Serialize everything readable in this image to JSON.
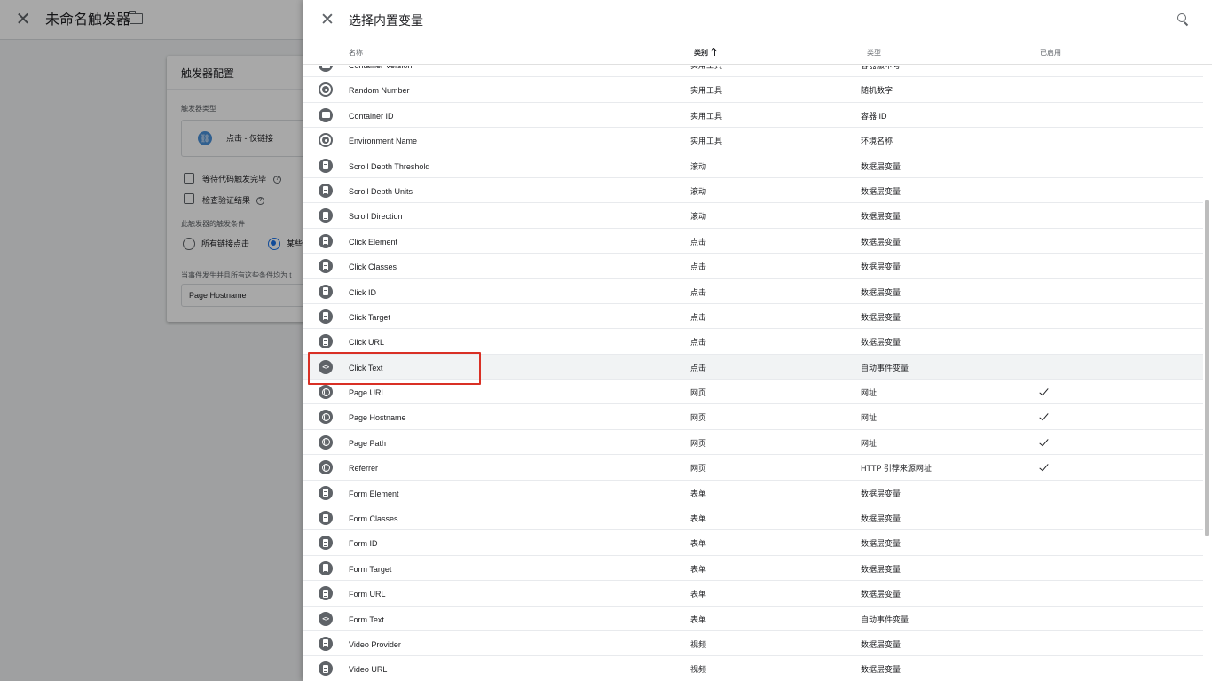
{
  "background": {
    "title": "未命名触发器",
    "card_title": "触发器配置",
    "trigger_type_label": "触发器类型",
    "trigger_type_value": "点击 - 仅链接",
    "wait_for_tags": "等待代码触发完毕",
    "check_validation": "检查验证结果",
    "fire_conditions_label": "此触发器的触发条件",
    "radio_all": "所有链接点击",
    "radio_some": "某些",
    "condition_text": "当事件发生并且所有这些条件均为 t",
    "condition_input_value": "Page Hostname"
  },
  "panel": {
    "title": "选择内置变量",
    "columns": {
      "name": "名称",
      "category": "类别",
      "type": "类型",
      "enabled": "已启用"
    }
  },
  "rows": [
    {
      "icon": "box",
      "name": "Container Version",
      "category": "实用工具",
      "type": "容器版本号",
      "enabled": false
    },
    {
      "icon": "gear",
      "name": "Random Number",
      "category": "实用工具",
      "type": "随机数字",
      "enabled": false
    },
    {
      "icon": "box",
      "name": "Container ID",
      "category": "实用工具",
      "type": "容器 ID",
      "enabled": false
    },
    {
      "icon": "gear",
      "name": "Environment Name",
      "category": "实用工具",
      "type": "环境名称",
      "enabled": false
    },
    {
      "icon": "doc",
      "name": "Scroll Depth Threshold",
      "category": "滚动",
      "type": "数据层变量",
      "enabled": false
    },
    {
      "icon": "doc",
      "name": "Scroll Depth Units",
      "category": "滚动",
      "type": "数据层变量",
      "enabled": false
    },
    {
      "icon": "doc",
      "name": "Scroll Direction",
      "category": "滚动",
      "type": "数据层变量",
      "enabled": false
    },
    {
      "icon": "doc",
      "name": "Click Element",
      "category": "点击",
      "type": "数据层变量",
      "enabled": false
    },
    {
      "icon": "doc",
      "name": "Click Classes",
      "category": "点击",
      "type": "数据层变量",
      "enabled": false
    },
    {
      "icon": "doc",
      "name": "Click ID",
      "category": "点击",
      "type": "数据层变量",
      "enabled": false
    },
    {
      "icon": "doc",
      "name": "Click Target",
      "category": "点击",
      "type": "数据层变量",
      "enabled": false
    },
    {
      "icon": "doc",
      "name": "Click URL",
      "category": "点击",
      "type": "数据层变量",
      "enabled": false
    },
    {
      "icon": "code",
      "name": "Click Text",
      "category": "点击",
      "type": "自动事件变量",
      "enabled": false,
      "highlighted": true
    },
    {
      "icon": "globe",
      "name": "Page URL",
      "category": "网页",
      "type": "网址",
      "enabled": true
    },
    {
      "icon": "globe",
      "name": "Page Hostname",
      "category": "网页",
      "type": "网址",
      "enabled": true
    },
    {
      "icon": "globe",
      "name": "Page Path",
      "category": "网页",
      "type": "网址",
      "enabled": true
    },
    {
      "icon": "globe",
      "name": "Referrer",
      "category": "网页",
      "type": "HTTP 引荐来源网址",
      "enabled": true
    },
    {
      "icon": "doc",
      "name": "Form Element",
      "category": "表单",
      "type": "数据层变量",
      "enabled": false
    },
    {
      "icon": "doc",
      "name": "Form Classes",
      "category": "表单",
      "type": "数据层变量",
      "enabled": false
    },
    {
      "icon": "doc",
      "name": "Form ID",
      "category": "表单",
      "type": "数据层变量",
      "enabled": false
    },
    {
      "icon": "doc",
      "name": "Form Target",
      "category": "表单",
      "type": "数据层变量",
      "enabled": false
    },
    {
      "icon": "doc",
      "name": "Form URL",
      "category": "表单",
      "type": "数据层变量",
      "enabled": false
    },
    {
      "icon": "code",
      "name": "Form Text",
      "category": "表单",
      "type": "自动事件变量",
      "enabled": false
    },
    {
      "icon": "doc",
      "name": "Video Provider",
      "category": "视频",
      "type": "数据层变量",
      "enabled": false
    },
    {
      "icon": "doc",
      "name": "Video URL",
      "category": "视频",
      "type": "数据层变量",
      "enabled": false
    }
  ]
}
